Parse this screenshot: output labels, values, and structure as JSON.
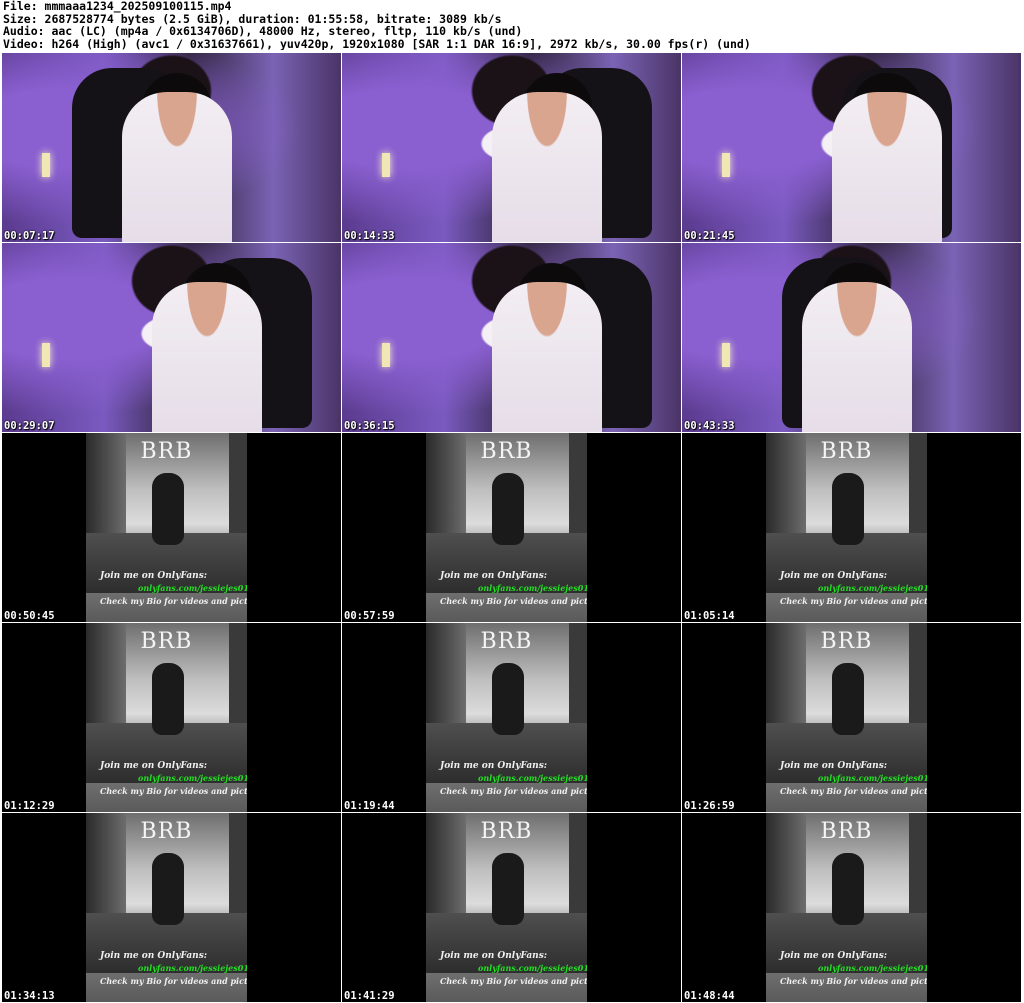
{
  "info": {
    "file": "File: mmmaaa1234_202509100115.mp4",
    "size": "Size: 2687528774 bytes (2.5 GiB), duration: 01:55:58, bitrate: 3089 kb/s",
    "audio": "Audio: aac (LC) (mp4a / 0x6134706D), 48000 Hz, stereo, fltp, 110 kb/s (und)",
    "video": "Video: h264 (High) (avc1 / 0x31637661), yuv420p, 1920x1080 [SAR 1:1 DAR 16:9], 2972 kb/s, 30.00 fps(r) (und)"
  },
  "thumbnails": [
    {
      "time": "00:07:17"
    },
    {
      "time": "00:14:33"
    },
    {
      "time": "00:21:45"
    },
    {
      "time": "00:29:07"
    },
    {
      "time": "00:36:15"
    },
    {
      "time": "00:43:33"
    },
    {
      "time": "00:50:45"
    },
    {
      "time": "00:57:59"
    },
    {
      "time": "01:05:14"
    },
    {
      "time": "01:12:29"
    },
    {
      "time": "01:19:44"
    },
    {
      "time": "01:26:59"
    },
    {
      "time": "01:34:13"
    },
    {
      "time": "01:41:29"
    },
    {
      "time": "01:48:44"
    }
  ],
  "brb": {
    "title": "BRB",
    "line1": "Join me on OnlyFans:",
    "line2": "onlyfans.com/jessiejes01",
    "line3": "Check my Bio for videos and pictures"
  }
}
